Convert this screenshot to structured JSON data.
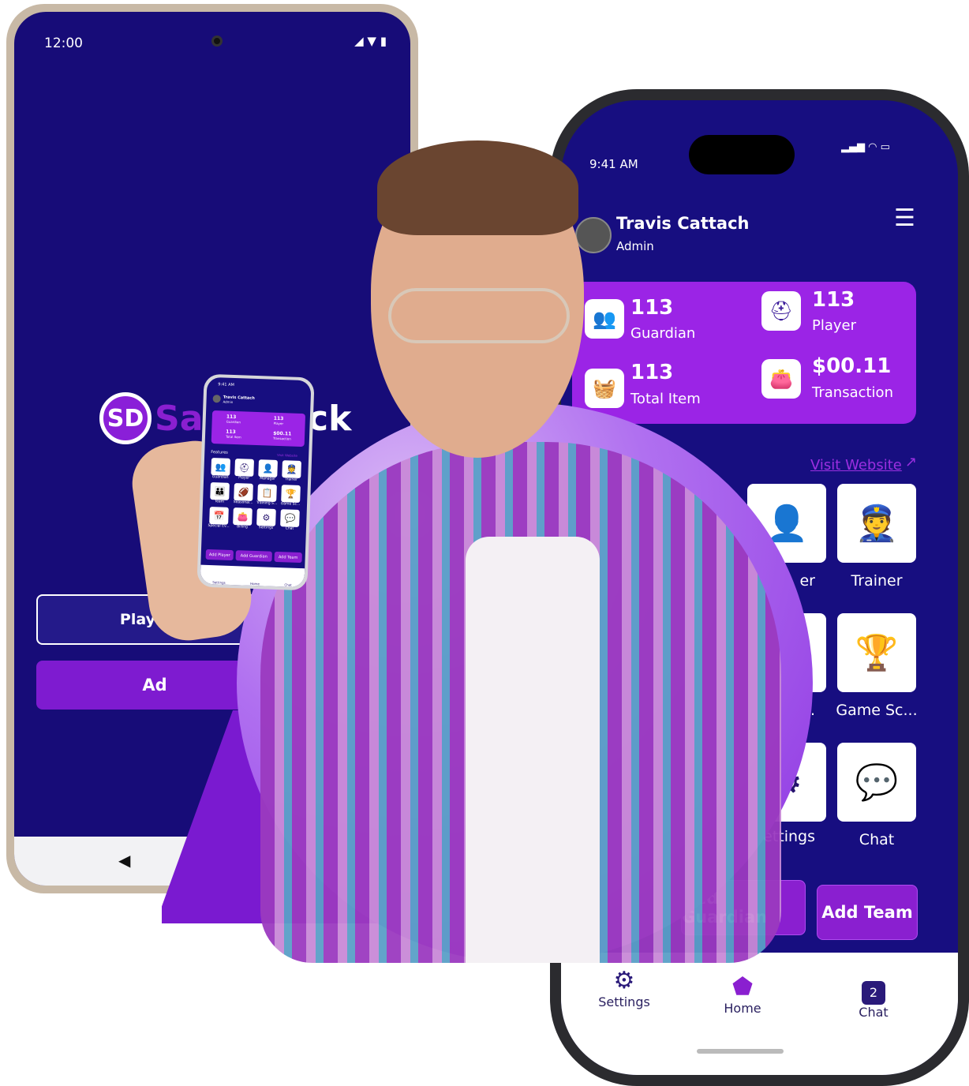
{
  "colors": {
    "screen_bg": "#170e80",
    "accent": "#8a1fd0",
    "white": "#ffffff"
  },
  "android": {
    "time": "12:00",
    "logo_initials": "SD",
    "logo_text_left": "Sa",
    "logo_text_right": "ck",
    "player_button": "Player/C",
    "add_button": "Ad",
    "back_icon": "triangle-back"
  },
  "iphone": {
    "time": "9:41 AM",
    "user": {
      "name": "Travis Cattach",
      "role": "Admin"
    },
    "stats": [
      {
        "value": "113",
        "label": "Guardian",
        "icon": "guardian-icon"
      },
      {
        "value": "113",
        "label": "Player",
        "icon": "player-icon"
      },
      {
        "value": "113",
        "label": "Total Item",
        "icon": "basket-icon"
      },
      {
        "value": "$00.11",
        "label": "Transaction",
        "icon": "wallet-icon"
      }
    ],
    "visit_website": "Visit Website",
    "tiles": [
      {
        "label": "er",
        "icon": "manager-icon"
      },
      {
        "label": "Trainer",
        "icon": "trainer-icon"
      },
      {
        "label": "...",
        "icon": ""
      },
      {
        "label": "Game Sc...",
        "icon": "trophy-icon"
      },
      {
        "label": "Settings",
        "icon": "gear-icon"
      },
      {
        "label": "Chat",
        "icon": "chat-icon"
      }
    ],
    "buttons": {
      "add_guardian": "Add Guardian",
      "add_team": "Add Team"
    },
    "nav": {
      "settings": "Settings",
      "home": "Home",
      "chat": "Chat",
      "chat_badge": "2"
    }
  },
  "mini_phone": {
    "time": "9:41 AM",
    "name": "Travis Cattach",
    "role": "Admin",
    "stats": [
      {
        "value": "113",
        "label": "Guardian"
      },
      {
        "value": "113",
        "label": "Player"
      },
      {
        "value": "113",
        "label": "Total Item"
      },
      {
        "value": "$00.11",
        "label": "Transaction"
      }
    ],
    "features_title": "Features",
    "visit_website": "Visit Website",
    "tiles": [
      "Guardian",
      "Player",
      "Manager",
      "Trainer",
      "Team",
      "Seasonal...",
      "Training S...",
      "Game Sc...",
      "Special Ev...",
      "Billing",
      "Settings",
      "Chat"
    ],
    "buttons": [
      "Add Player",
      "Add Guardian",
      "Add Team"
    ],
    "nav": [
      "Settings",
      "Home",
      "Chat"
    ]
  }
}
